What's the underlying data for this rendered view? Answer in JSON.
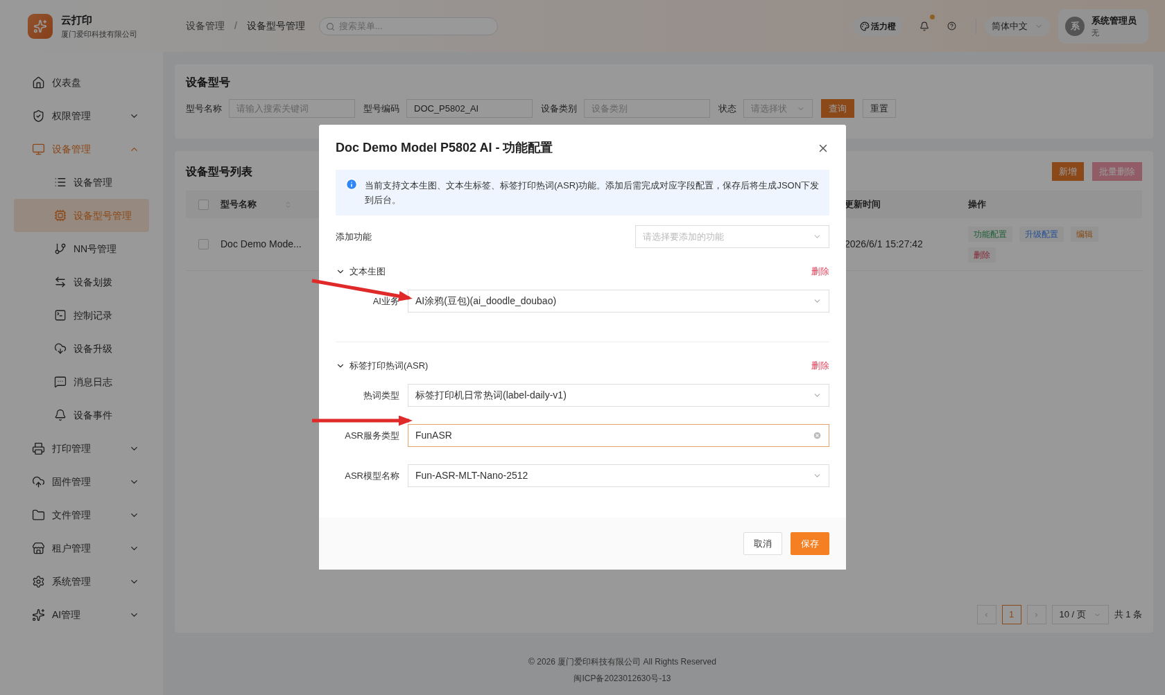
{
  "header": {
    "app_name": "云打印",
    "company": "厦门爱印科技有限公司",
    "breadcrumb": [
      "设备管理",
      "设备型号管理"
    ],
    "breadcrumb_separator": "/",
    "search": {
      "placeholder": "搜索菜单..."
    },
    "theme": "活力橙",
    "notification_dot": true,
    "language": "简体中文",
    "user": {
      "avatar": "系",
      "name": "系统管理员",
      "role": "无"
    }
  },
  "sidebar": {
    "items": [
      {
        "label": "仪表盘",
        "selected": false
      },
      {
        "label": "权限管理",
        "selected": false,
        "expanded": false
      },
      {
        "label": "设备管理",
        "selected": true,
        "expanded": true,
        "children": [
          {
            "label": "设备管理",
            "selected": false
          },
          {
            "label": "设备型号管理",
            "selected": true
          },
          {
            "label": "NN号管理",
            "selected": false
          },
          {
            "label": "设备划拨",
            "selected": false
          },
          {
            "label": "控制记录",
            "selected": false
          },
          {
            "label": "设备升级",
            "selected": false
          },
          {
            "label": "消息日志",
            "selected": false
          },
          {
            "label": "设备事件",
            "selected": false
          }
        ]
      },
      {
        "label": "打印管理",
        "selected": false,
        "expanded": false
      },
      {
        "label": "固件管理",
        "selected": false,
        "expanded": false
      },
      {
        "label": "文件管理",
        "selected": false,
        "expanded": false
      },
      {
        "label": "租户管理",
        "selected": false,
        "expanded": false
      },
      {
        "label": "系统管理",
        "selected": false,
        "expanded": false
      },
      {
        "label": "AI管理",
        "selected": false,
        "expanded": false
      }
    ]
  },
  "filter": {
    "title": "设备型号",
    "fields": [
      {
        "kind": "input",
        "label": "型号名称",
        "placeholder": "请输入搜索关键词"
      },
      {
        "kind": "input",
        "label": "型号编码",
        "value": "DOC_P5802_AI"
      },
      {
        "kind": "input",
        "label": "设备类别",
        "placeholder": "设备类别"
      },
      {
        "kind": "select",
        "label": "状态",
        "placeholder": "请选择状"
      }
    ],
    "buttons": [
      {
        "label": "查询",
        "kind": "primary"
      },
      {
        "label": "重置",
        "kind": "default"
      }
    ]
  },
  "list": {
    "title": "设备型号列表",
    "buttons": [
      {
        "label": "新增",
        "kind": "primary"
      },
      {
        "label": "批量删除",
        "kind": "danger"
      }
    ],
    "all_checked": false,
    "columns": [
      "型号名称",
      "更新时间",
      "操作"
    ],
    "rows": [
      {
        "checked": false,
        "name": "Doc Demo Mode...",
        "updated": "2026/6/1 15:27:42",
        "actions": [
          {
            "label": "功能配置"
          },
          {
            "label": "升级配置"
          },
          {
            "label": "编辑"
          },
          {
            "label": "删除"
          }
        ]
      }
    ],
    "pagination": {
      "prev": "‹",
      "pages": [
        {
          "label": "1",
          "selected": true
        }
      ],
      "next": "›",
      "page_size": "10 / 页",
      "total": "共 1 条"
    }
  },
  "footer": {
    "copyright": "© 2026 厦门爱印科技有限公司 All Rights Reserved",
    "icp": "闽ICP备2023012630号-13"
  },
  "dialog": {
    "title": "Doc Demo Model P5802 AI - 功能配置",
    "info": "当前支持文本生图、文本生标签、标签打印热词(ASR)功能。添加后需完成对应字段配置，保存后将生成JSON下发到后台。",
    "add_feature": {
      "label": "添加功能",
      "placeholder": "请选择要添加的功能"
    },
    "sections": [
      {
        "title": "文本生图",
        "expanded": true,
        "delete": "删除",
        "fields": [
          {
            "label": "AI业务",
            "value": "AI涂鸦(豆包)(ai_doodle_doubao)",
            "focused": false
          }
        ]
      },
      {
        "title": "标签打印热词(ASR)",
        "expanded": true,
        "delete": "删除",
        "fields": [
          {
            "label": "热词类型",
            "value": "标签打印机日常热词(label-daily-v1)",
            "focused": false
          },
          {
            "label": "ASR服务类型",
            "value": "FunASR",
            "focused": true
          },
          {
            "label": "ASR模型名称",
            "value": "Fun-ASR-MLT-Nano-2512",
            "focused": false
          }
        ]
      }
    ],
    "buttons": [
      {
        "label": "取消",
        "kind": "default"
      },
      {
        "label": "保存",
        "kind": "primary"
      }
    ]
  }
}
